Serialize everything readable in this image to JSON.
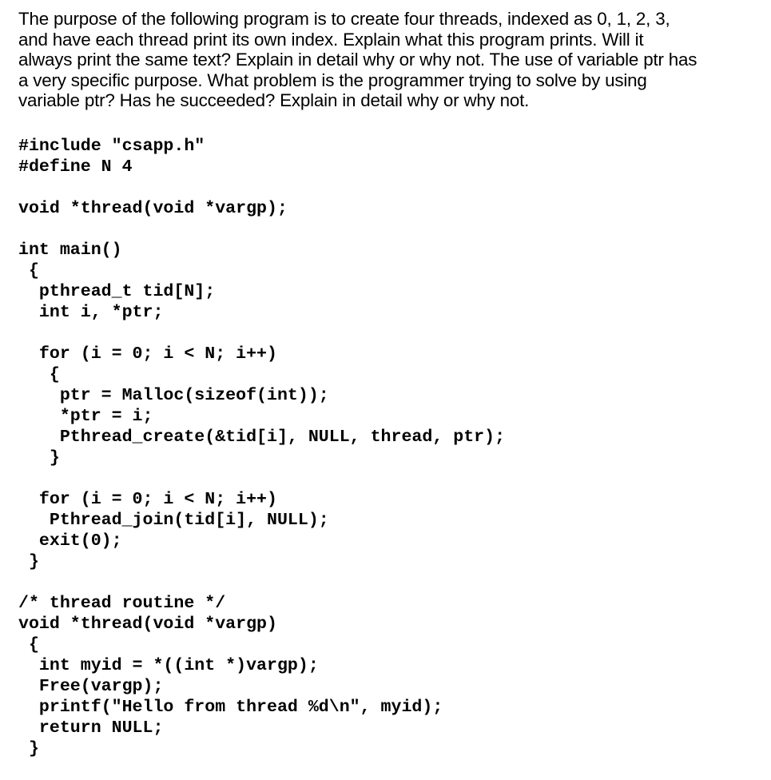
{
  "question": {
    "lines": [
      "The purpose of the following program is to create four threads, indexed as 0, 1, 2, 3,",
      "and have each thread print its own index. Explain what this program prints. Will it",
      "always print the same text? Explain in detail why or why not. The use of variable ptr has",
      "a very specific purpose. What problem is the programmer trying to solve by using",
      "variable ptr? Has he succeeded? Explain in detail why or why not."
    ]
  },
  "code": {
    "lines": [
      "#include \"csapp.h\"",
      "#define N 4",
      "",
      "void *thread(void *vargp);",
      "",
      "int main()",
      " {",
      "  pthread_t tid[N];",
      "  int i, *ptr;",
      "",
      "  for (i = 0; i < N; i++)",
      "   {",
      "    ptr = Malloc(sizeof(int));",
      "    *ptr = i;",
      "    Pthread_create(&tid[i], NULL, thread, ptr);",
      "   }",
      "",
      "  for (i = 0; i < N; i++)",
      "   Pthread_join(tid[i], NULL);",
      "  exit(0);",
      " }",
      "",
      "/* thread routine */",
      "void *thread(void *vargp)",
      " {",
      "  int myid = *((int *)vargp);",
      "  Free(vargp);",
      "  printf(\"Hello from thread %d\\n\", myid);",
      "  return NULL;",
      " }"
    ]
  }
}
